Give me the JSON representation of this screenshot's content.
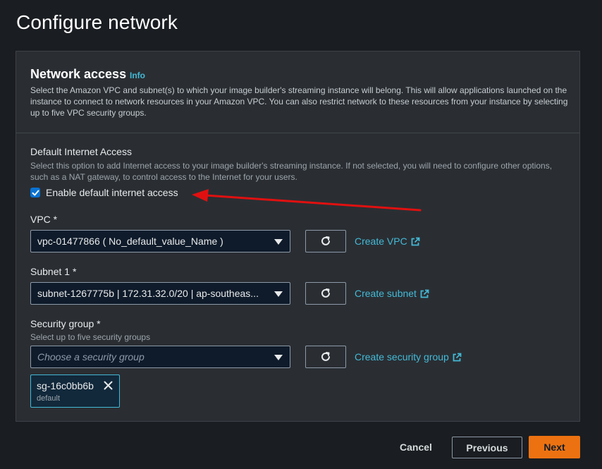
{
  "page": {
    "title": "Configure network"
  },
  "network_access": {
    "title": "Network access",
    "info_label": "Info",
    "description": "Select the Amazon VPC and subnet(s) to which your image builder's streaming instance will belong. This will allow applications launched on the instance to connect to network resources in your Amazon VPC. You can also restrict network to these resources from your instance by selecting up to five VPC security groups."
  },
  "internet_access": {
    "label": "Default Internet Access",
    "hint": "Select this option to add Internet access to your image builder's streaming instance. If not selected, you will need to configure other options, such as a NAT gateway, to control access to the Internet for your users.",
    "checkbox_label": "Enable default internet access",
    "checked": true
  },
  "vpc": {
    "label": "VPC *",
    "value": "vpc-01477866 ( No_default_value_Name )",
    "create_label": "Create VPC"
  },
  "subnet": {
    "label": "Subnet 1 *",
    "value": "subnet-1267775b | 172.31.32.0/20 | ap-southeas...",
    "create_label": "Create subnet"
  },
  "security_group": {
    "label": "Security group *",
    "hint": "Select up to five security groups",
    "placeholder": "Choose a security group",
    "create_label": "Create security group",
    "selected": [
      {
        "name": "sg-16c0bb6b",
        "description": "default"
      }
    ]
  },
  "footer": {
    "cancel_label": "Cancel",
    "previous_label": "Previous",
    "next_label": "Next"
  },
  "colors": {
    "accent_orange": "#ec7211",
    "link_blue": "#44b9d6",
    "checkbox_blue": "#0972d3",
    "annotation_arrow": "#e01010"
  },
  "icons": {
    "refresh": "refresh-icon",
    "external": "external-link-icon",
    "caret": "caret-down-icon",
    "close": "close-icon",
    "check": "check-icon"
  }
}
